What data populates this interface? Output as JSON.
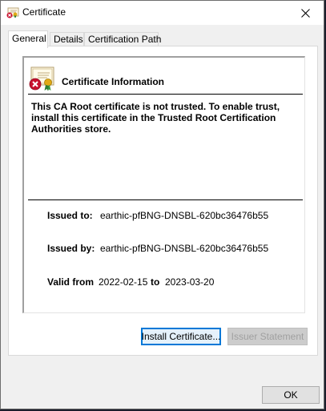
{
  "window": {
    "title": "Certificate"
  },
  "tabs": [
    {
      "label": "General",
      "active": true
    },
    {
      "label": "Details",
      "active": false
    },
    {
      "label": "Certification Path",
      "active": false
    }
  ],
  "info": {
    "heading": "Certificate Information",
    "warning": "This CA Root certificate is not trusted. To enable trust, install this certificate in the Trusted Root Certification Authorities store.",
    "issued_to_label": "Issued to:",
    "issued_to_value": "earthic-pfBNG-DNSBL-620bc36476b55",
    "issued_by_label": "Issued by:",
    "issued_by_value": "earthic-pfBNG-DNSBL-620bc36476b55",
    "valid_from_label": "Valid from",
    "valid_from_value": "2022-02-15",
    "valid_to_label": "to",
    "valid_to_value": "2023-03-20"
  },
  "buttons": {
    "install": "Install Certificate...",
    "issuer_statement": "Issuer Statement",
    "ok": "OK"
  },
  "colors": {
    "accent": "#0078d7",
    "error_red": "#c8102e",
    "ribbon_gold": "#e1a914"
  },
  "icons": {
    "title": "certificate-error-icon",
    "close": "close-icon",
    "big": "certificate-error-icon"
  }
}
